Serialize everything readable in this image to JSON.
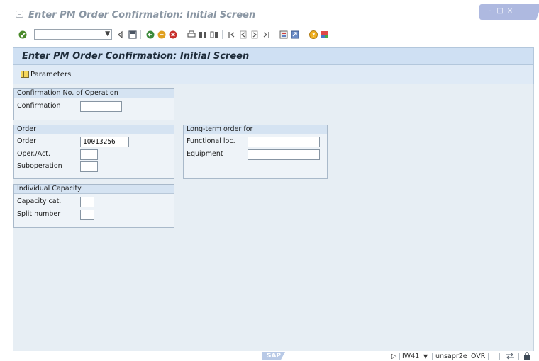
{
  "window": {
    "title": "Enter PM Order Confirmation: Initial Screen"
  },
  "toolbar": {
    "command_field_value": ""
  },
  "screen": {
    "title": "Enter PM Order Confirmation: Initial Screen",
    "app_buttons": {
      "parameters": "Parameters"
    }
  },
  "groups": {
    "confirmation_no": {
      "title": "Confirmation No. of Operation",
      "confirmation": {
        "label": "Confirmation",
        "value": ""
      }
    },
    "order": {
      "title": "Order",
      "order": {
        "label": "Order",
        "value": "10013256"
      },
      "oper_act": {
        "label": "Oper./Act.",
        "value": ""
      },
      "suboperation": {
        "label": "Suboperation",
        "value": ""
      }
    },
    "long_term_order": {
      "title": "Long-term order for",
      "functional_loc": {
        "label": "Functional loc.",
        "value": ""
      },
      "equipment": {
        "label": "Equipment",
        "value": ""
      }
    },
    "individual_capacity": {
      "title": "Individual Capacity",
      "capacity_cat": {
        "label": "Capacity cat.",
        "value": ""
      },
      "split_number": {
        "label": "Split number",
        "value": ""
      }
    }
  },
  "status_bar": {
    "logo_text": "SAP",
    "transaction": "IW41",
    "user": "unsapr2e",
    "mode": "OVR"
  },
  "colors": {
    "header_bg": "#cfe0f3",
    "content_bg": "#e7eef4",
    "group_title_bg": "#d5e3f2"
  }
}
